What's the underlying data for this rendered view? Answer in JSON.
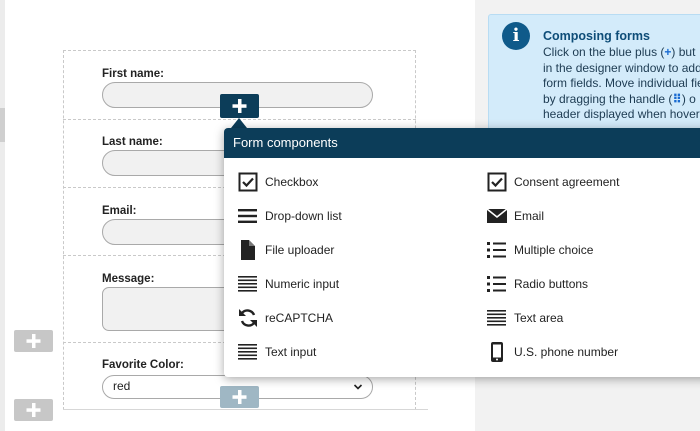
{
  "info": {
    "icon": "info-icon",
    "title": "Composing forms",
    "lines": [
      {
        "before": "Click on the blue plus (",
        "after": ") but"
      },
      {
        "text": "in the designer window to add"
      },
      {
        "text": "form fields. Move individual fie"
      },
      {
        "before": "by dragging the handle (",
        "after": ") o"
      },
      {
        "text": "header displayed when hoveri"
      }
    ]
  },
  "fields": {
    "first_name": "First name:",
    "last_name": "Last name:",
    "email": "Email:",
    "message": "Message:",
    "favorite_color": "Favorite Color:",
    "favorite_color_value": "red"
  },
  "popup": {
    "title": "Form components",
    "left_items": [
      {
        "label": "Checkbox",
        "icon": "checkbox-icon"
      },
      {
        "label": "Drop-down list",
        "icon": "dropdown-list-icon"
      },
      {
        "label": "File uploader",
        "icon": "file-icon"
      },
      {
        "label": "Numeric input",
        "icon": "numeric-input-icon"
      },
      {
        "label": "reCAPTCHA",
        "icon": "recaptcha-icon"
      },
      {
        "label": "Text input",
        "icon": "text-input-icon"
      }
    ],
    "right_items": [
      {
        "label": "Consent agreement",
        "icon": "consent-checkbox-icon"
      },
      {
        "label": "Email",
        "icon": "envelope-icon"
      },
      {
        "label": "Multiple choice",
        "icon": "list-icon"
      },
      {
        "label": "Radio buttons",
        "icon": "radio-list-icon"
      },
      {
        "label": "Text area",
        "icon": "text-area-icon"
      },
      {
        "label": "U.S. phone number",
        "icon": "phone-icon"
      }
    ]
  },
  "colors": {
    "dark_teal": "#0c3d59",
    "info_bg": "#d3ebfa",
    "plus_blue": "#1a6bd1"
  }
}
